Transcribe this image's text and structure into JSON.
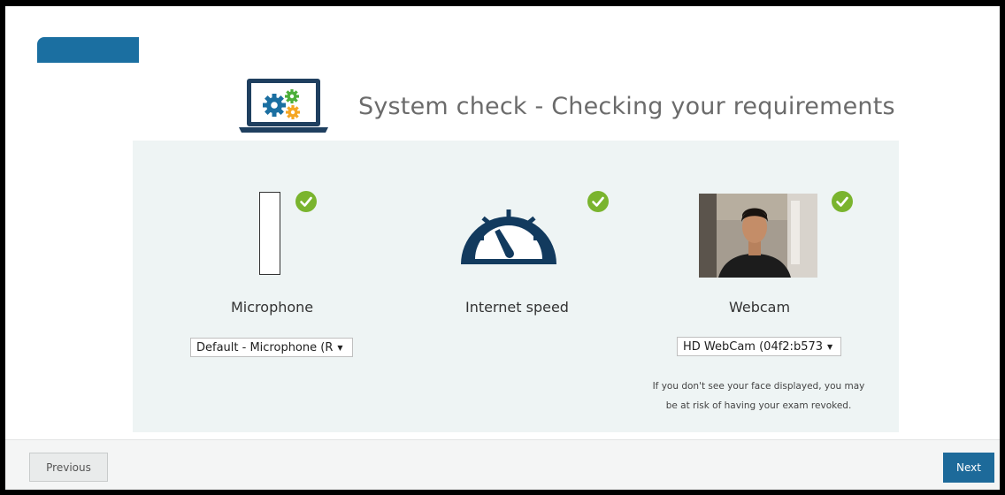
{
  "header": {
    "title": "System check - Checking your requirements",
    "icon": "laptop-gears-icon"
  },
  "checks": {
    "microphone": {
      "label": "Microphone",
      "device_value": "Default - Microphone (R",
      "status": "passed",
      "status_icon": "check-circle-icon"
    },
    "internet": {
      "label": "Internet speed",
      "status": "passed",
      "status_icon": "check-circle-icon",
      "icon": "speedometer-icon"
    },
    "webcam": {
      "label": "Webcam",
      "device_value": "HD WebCam (04f2:b573",
      "status": "passed",
      "status_icon": "check-circle-icon",
      "note_line1": "If you don't see your face displayed, you may",
      "note_line2": "be at risk of having your exam revoked."
    }
  },
  "footer": {
    "previous_label": "Previous",
    "next_label": "Next"
  },
  "colors": {
    "accent": "#1d6a9a",
    "check_green": "#7ab42e",
    "gauge_navy": "#123a5e",
    "panel_bg": "#eef4f4"
  }
}
